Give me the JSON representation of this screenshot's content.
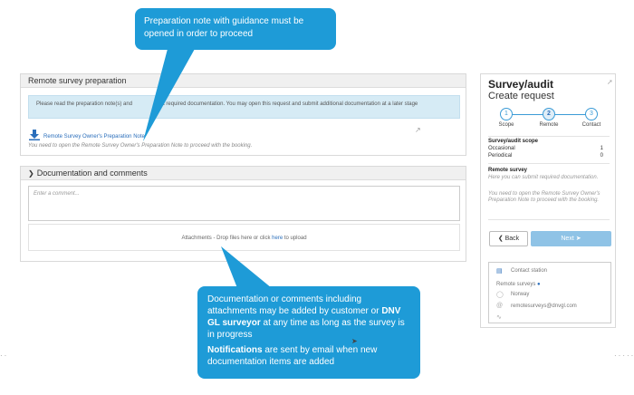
{
  "prep": {
    "heading": "Remote survey preparation",
    "info_text_a": "Please read the preparation note(s) and",
    "info_text_b": "t required documentation. You may open this request and submit additional documentation at a later stage",
    "download_link": "Remote Survey Owner's Preparation Note",
    "note": "You need to open the Remote Survey Owner's Preparation Note to proceed with the booking."
  },
  "docs": {
    "heading": "Documentation and comments",
    "comment_placeholder": "Enter a comment...",
    "attach_text_before": "Attachments - Drop files here or click ",
    "attach_link": "here",
    "attach_text_after": " to upload"
  },
  "sidebar": {
    "title": "Survey/audit",
    "subtitle": "Create request",
    "steps": [
      {
        "num": "1",
        "label": "Scope"
      },
      {
        "num": "2",
        "label": "Remote"
      },
      {
        "num": "3",
        "label": "Contact"
      }
    ],
    "scope_title": "Survey/audit scope",
    "scope_rows": [
      {
        "label": "Occasional",
        "value": "1"
      },
      {
        "label": "Periodical",
        "value": "0"
      }
    ],
    "remote_title": "Remote survey",
    "remote_desc": "Here you can submit required documentation.",
    "remote_note": "You need to open the Remote Survey Owner's Preparation Note to proceed with the booking.",
    "back_label": "Back",
    "next_label": "Next",
    "contact_title": "Contact station",
    "contact_sub": "Remote surveys",
    "contact_country": "Norway",
    "contact_email": "remotesurveys@dnvgl.com"
  },
  "callouts": {
    "top": "Preparation note with guidance must be opened in order to proceed",
    "bottom_p1_a": "Documentation or comments including attachments may be added by customer or ",
    "bottom_p1_bold": "DNV GL surveyor",
    "bottom_p1_b": " at any time as long as the survey is in progress",
    "bottom_p2_bold": "Notifications",
    "bottom_p2_b": " are sent by email when new documentation items are added"
  },
  "colors": {
    "accent": "#1e9bd7",
    "link": "#2a6ebb",
    "info_bg": "#d6ebf5",
    "next_btn": "#8fc3e6"
  }
}
